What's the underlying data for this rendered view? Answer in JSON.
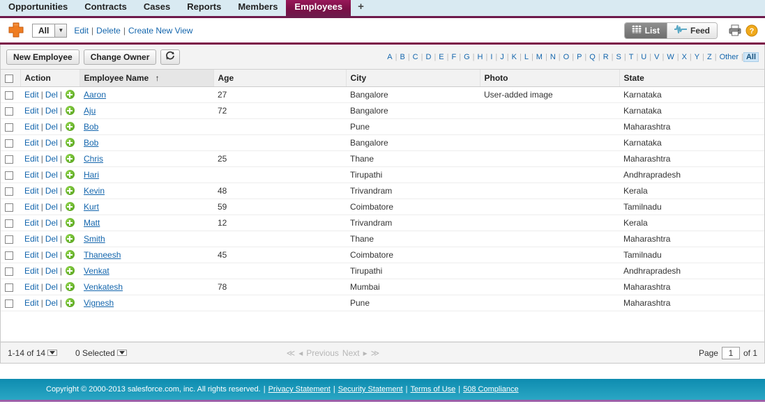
{
  "tabs": [
    {
      "label": "Opportunities",
      "active": false
    },
    {
      "label": "Contracts",
      "active": false
    },
    {
      "label": "Cases",
      "active": false
    },
    {
      "label": "Reports",
      "active": false
    },
    {
      "label": "Members",
      "active": false
    },
    {
      "label": "Employees",
      "active": true
    }
  ],
  "tab_add_label": "+",
  "view": {
    "icon": "puzzle-piece-icon",
    "selected": "All",
    "dropdown_glyph": "▼",
    "edit_label": "Edit",
    "delete_label": "Delete",
    "create_label": "Create New View",
    "sep": "|"
  },
  "modes": {
    "list_label": "List",
    "feed_label": "Feed",
    "active": "List",
    "print_icon": "printer-icon",
    "help_icon": "help-icon"
  },
  "toolbar": {
    "new_label": "New Employee",
    "owner_label": "Change Owner",
    "refresh_icon": "refresh-icon"
  },
  "alpha": {
    "letters": [
      "A",
      "B",
      "C",
      "D",
      "E",
      "F",
      "G",
      "H",
      "I",
      "J",
      "K",
      "L",
      "M",
      "N",
      "O",
      "P",
      "Q",
      "R",
      "S",
      "T",
      "U",
      "V",
      "W",
      "X",
      "Y",
      "Z"
    ],
    "other_label": "Other",
    "all_label": "All",
    "selected": "All"
  },
  "table": {
    "columns": [
      {
        "label": "Action",
        "key": "action"
      },
      {
        "label": "Employee Name",
        "key": "name",
        "sorted": true,
        "sort_glyph": "↑"
      },
      {
        "label": "Age",
        "key": "age"
      },
      {
        "label": "City",
        "key": "city"
      },
      {
        "label": "Photo",
        "key": "photo"
      },
      {
        "label": "State",
        "key": "state"
      }
    ],
    "row_actions": {
      "edit": "Edit",
      "del": "Del",
      "add_icon": "add-circle-icon"
    },
    "rows": [
      {
        "name": "Aaron",
        "age": "27",
        "city": "Bangalore",
        "photo": "User-added image",
        "state": "Karnataka"
      },
      {
        "name": "Aju",
        "age": "72",
        "city": "Bangalore",
        "photo": "",
        "state": "Karnataka"
      },
      {
        "name": "Bob",
        "age": "",
        "city": "Pune",
        "photo": "",
        "state": "Maharashtra"
      },
      {
        "name": "Bob",
        "age": "",
        "city": "Bangalore",
        "photo": "",
        "state": "Karnataka"
      },
      {
        "name": "Chris",
        "age": "25",
        "city": "Thane",
        "photo": "",
        "state": "Maharashtra"
      },
      {
        "name": "Hari",
        "age": "",
        "city": "Tirupathi",
        "photo": "",
        "state": "Andhrapradesh"
      },
      {
        "name": "Kevin",
        "age": "48",
        "city": "Trivandram",
        "photo": "",
        "state": "Kerala"
      },
      {
        "name": "Kurt",
        "age": "59",
        "city": "Coimbatore",
        "photo": "",
        "state": "Tamilnadu"
      },
      {
        "name": "Matt",
        "age": "12",
        "city": "Trivandram",
        "photo": "",
        "state": "Kerala"
      },
      {
        "name": "Smith",
        "age": "",
        "city": "Thane",
        "photo": "",
        "state": "Maharashtra"
      },
      {
        "name": "Thaneesh",
        "age": "45",
        "city": "Coimbatore",
        "photo": "",
        "state": "Tamilnadu"
      },
      {
        "name": "Venkat",
        "age": "",
        "city": "Tirupathi",
        "photo": "",
        "state": "Andhrapradesh"
      },
      {
        "name": "Venkatesh",
        "age": "78",
        "city": "Mumbai",
        "photo": "",
        "state": "Maharashtra"
      },
      {
        "name": "Vignesh",
        "age": "",
        "city": "Pune",
        "photo": "",
        "state": "Maharashtra"
      }
    ]
  },
  "footer": {
    "range_label": "1-14 of 14",
    "selected_label": "0 Selected",
    "first_glyph": "≪",
    "prev_arrow": "◂",
    "prev_label": "Previous",
    "next_label": "Next",
    "next_arrow": "▸",
    "last_glyph": "≫",
    "page_label": "Page",
    "page_value": "1",
    "of_label": "of 1"
  },
  "copyright": {
    "text": "Copyright © 2000-2013 salesforce.com, inc. All rights reserved.",
    "sep": "|",
    "links": [
      "Privacy Statement",
      "Security Statement",
      "Terms of Use",
      "508 Compliance"
    ]
  },
  "colors": {
    "tab_active": "#7b0f46",
    "tabbar_bg": "#d9eaf2",
    "link": "#1466ad",
    "footer_bg": "#1a96b8",
    "footer_rule": "#9b5fa8",
    "add_icon": "#4f9c18"
  }
}
